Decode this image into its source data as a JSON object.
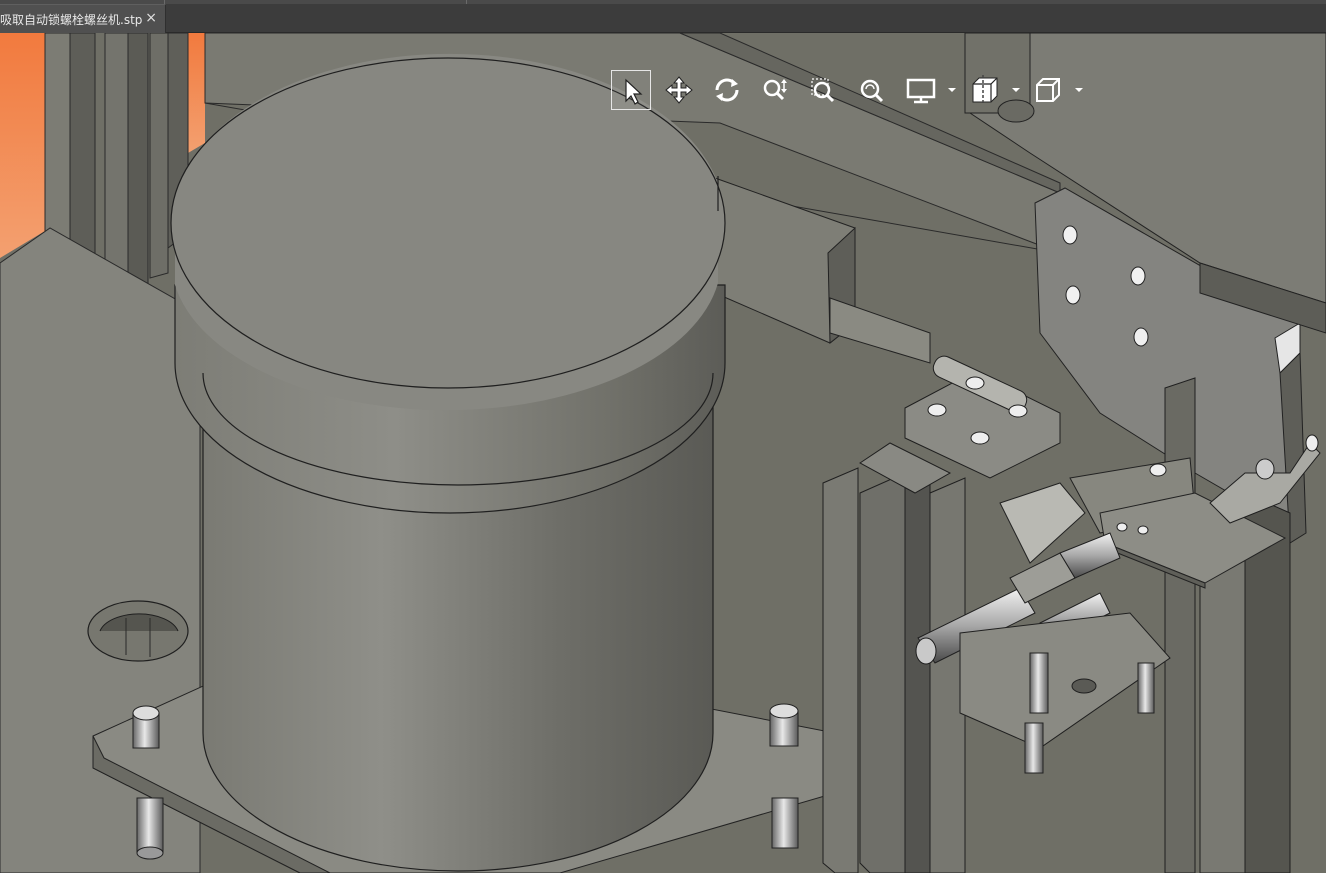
{
  "tab": {
    "title": "吸取自动锁螺栓螺丝机.stp",
    "close_glyph": "×"
  },
  "toolbar": {
    "tools": [
      {
        "name": "select-tool",
        "icon": "cursor-arrow-icon",
        "active": true
      },
      {
        "name": "pan-tool",
        "icon": "move-arrows-icon"
      },
      {
        "name": "rotate-tool",
        "icon": "rotate-icon"
      },
      {
        "name": "zoom-tool",
        "icon": "zoom-updown-icon"
      },
      {
        "name": "zoom-window-tool",
        "icon": "zoom-window-icon"
      },
      {
        "name": "zoom-fit-tool",
        "icon": "zoom-fit-icon"
      },
      {
        "name": "display-mode-tool",
        "icon": "monitor-icon",
        "dropdown": true
      },
      {
        "name": "section-view-tool",
        "icon": "section-box-icon",
        "dropdown": true
      },
      {
        "name": "view-orientation-tool",
        "icon": "cube-icon",
        "dropdown": true
      }
    ]
  },
  "colors": {
    "background": "#6f6f66",
    "tab_bar": "#3c3c3c",
    "active_tab": "#505050",
    "model_gray": "#8a8a84",
    "accent_orange": "#f08040",
    "icon_white": "#ffffff"
  }
}
